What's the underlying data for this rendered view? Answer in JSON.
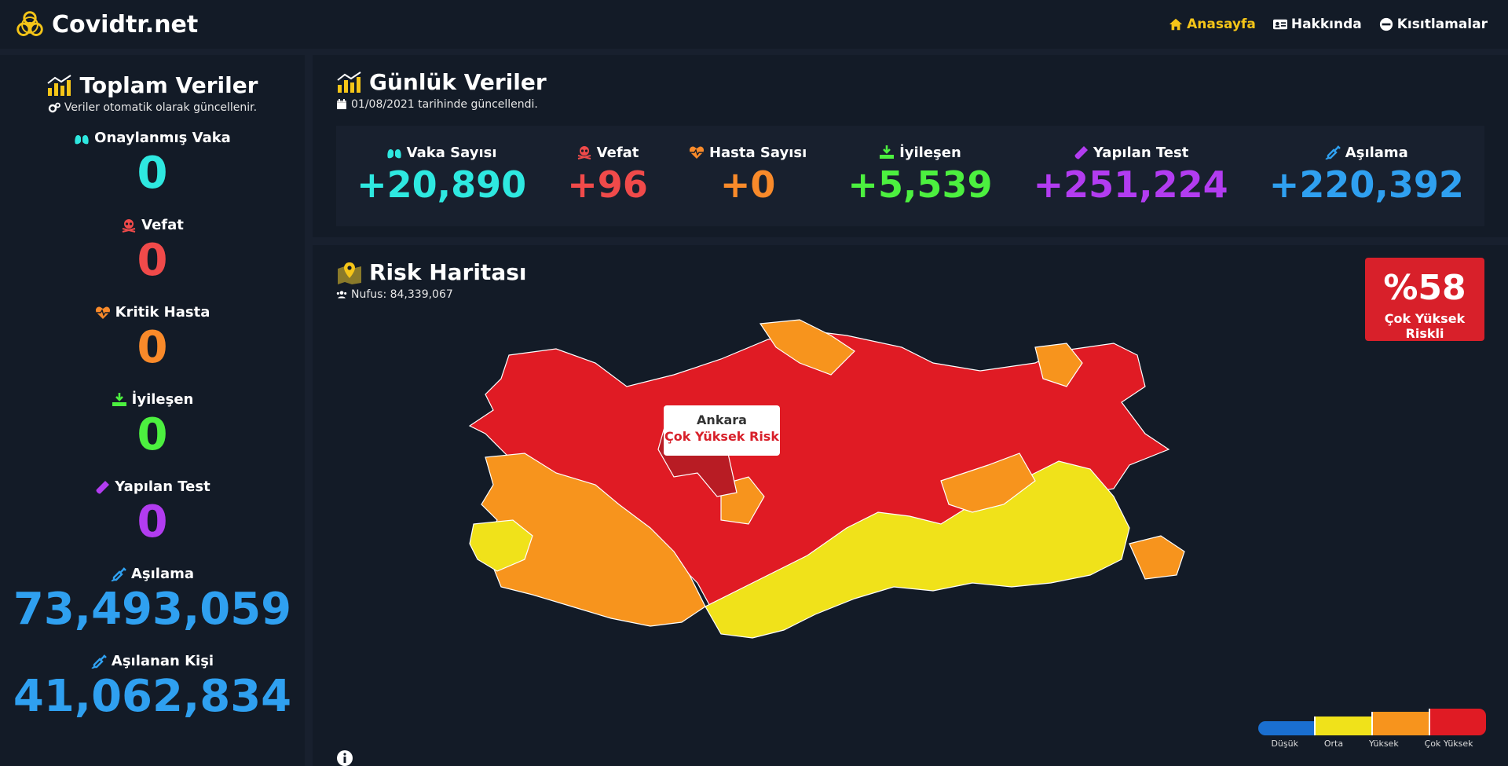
{
  "brand": {
    "name": "Covidtr.net"
  },
  "nav": [
    {
      "label": "Anasayfa",
      "icon": "home-icon",
      "active": true
    },
    {
      "label": "Hakkında",
      "icon": "id-card-icon",
      "active": false
    },
    {
      "label": "Kısıtlamalar",
      "icon": "minus-circle-icon",
      "active": false
    }
  ],
  "totals": {
    "title": "Toplam Veriler",
    "subtitle": "Veriler otomatik olarak güncellenir.",
    "items": [
      {
        "label": "Onaylanmış Vaka",
        "value": "0",
        "color": "#2ee8e0",
        "icon": "lungs-icon"
      },
      {
        "label": "Vefat",
        "value": "0",
        "color": "#f04a4a",
        "icon": "skull-icon"
      },
      {
        "label": "Kritik Hasta",
        "value": "0",
        "color": "#f98a2a",
        "icon": "heartbeat-icon"
      },
      {
        "label": "İyileşen",
        "value": "0",
        "color": "#4cf03f",
        "icon": "recover-icon"
      },
      {
        "label": "Yapılan Test",
        "value": "0",
        "color": "#b23cf0",
        "icon": "test-tube-icon"
      },
      {
        "label": "Aşılama",
        "value": "73,493,059",
        "color": "#2fa0f0",
        "icon": "syringe-icon"
      },
      {
        "label": "Aşılanan Kişi",
        "value": "41,062,834",
        "color": "#2fa0f0",
        "icon": "syringe-icon"
      }
    ]
  },
  "daily": {
    "title": "Günlük Veriler",
    "updated": "01/08/2021 tarihinde güncellendi.",
    "items": [
      {
        "label": "Vaka Sayısı",
        "value": "+20,890",
        "color": "#2ee8e0",
        "icon": "lungs-icon"
      },
      {
        "label": "Vefat",
        "value": "+96",
        "color": "#f04a4a",
        "icon": "skull-icon"
      },
      {
        "label": "Hasta Sayısı",
        "value": "+0",
        "color": "#f98a2a",
        "icon": "heartbeat-icon"
      },
      {
        "label": "İyileşen",
        "value": "+5,539",
        "color": "#4cf03f",
        "icon": "recover-icon"
      },
      {
        "label": "Yapılan Test",
        "value": "+251,224",
        "color": "#b23cf0",
        "icon": "test-tube-icon"
      },
      {
        "label": "Aşılama",
        "value": "+220,392",
        "color": "#2fa0f0",
        "icon": "syringe-icon"
      }
    ]
  },
  "risk": {
    "title": "Risk Haritası",
    "population": "Nufus: 84,339,067",
    "badge_pct": "%58",
    "badge_level": "Çok Yüksek Riskli",
    "tooltip": {
      "name": "Ankara",
      "risk": "Çok Yüksek Risk"
    },
    "legend": [
      {
        "label": "Düşük",
        "color": "#1a6fd0"
      },
      {
        "label": "Orta",
        "color": "#f0e21a"
      },
      {
        "label": "Yüksek",
        "color": "#f7941d"
      },
      {
        "label": "Çok Yüksek",
        "color": "#e01b24"
      }
    ]
  },
  "colors": {
    "accent": "#f5c518",
    "background": "#18202e",
    "panel": "#131b27"
  }
}
